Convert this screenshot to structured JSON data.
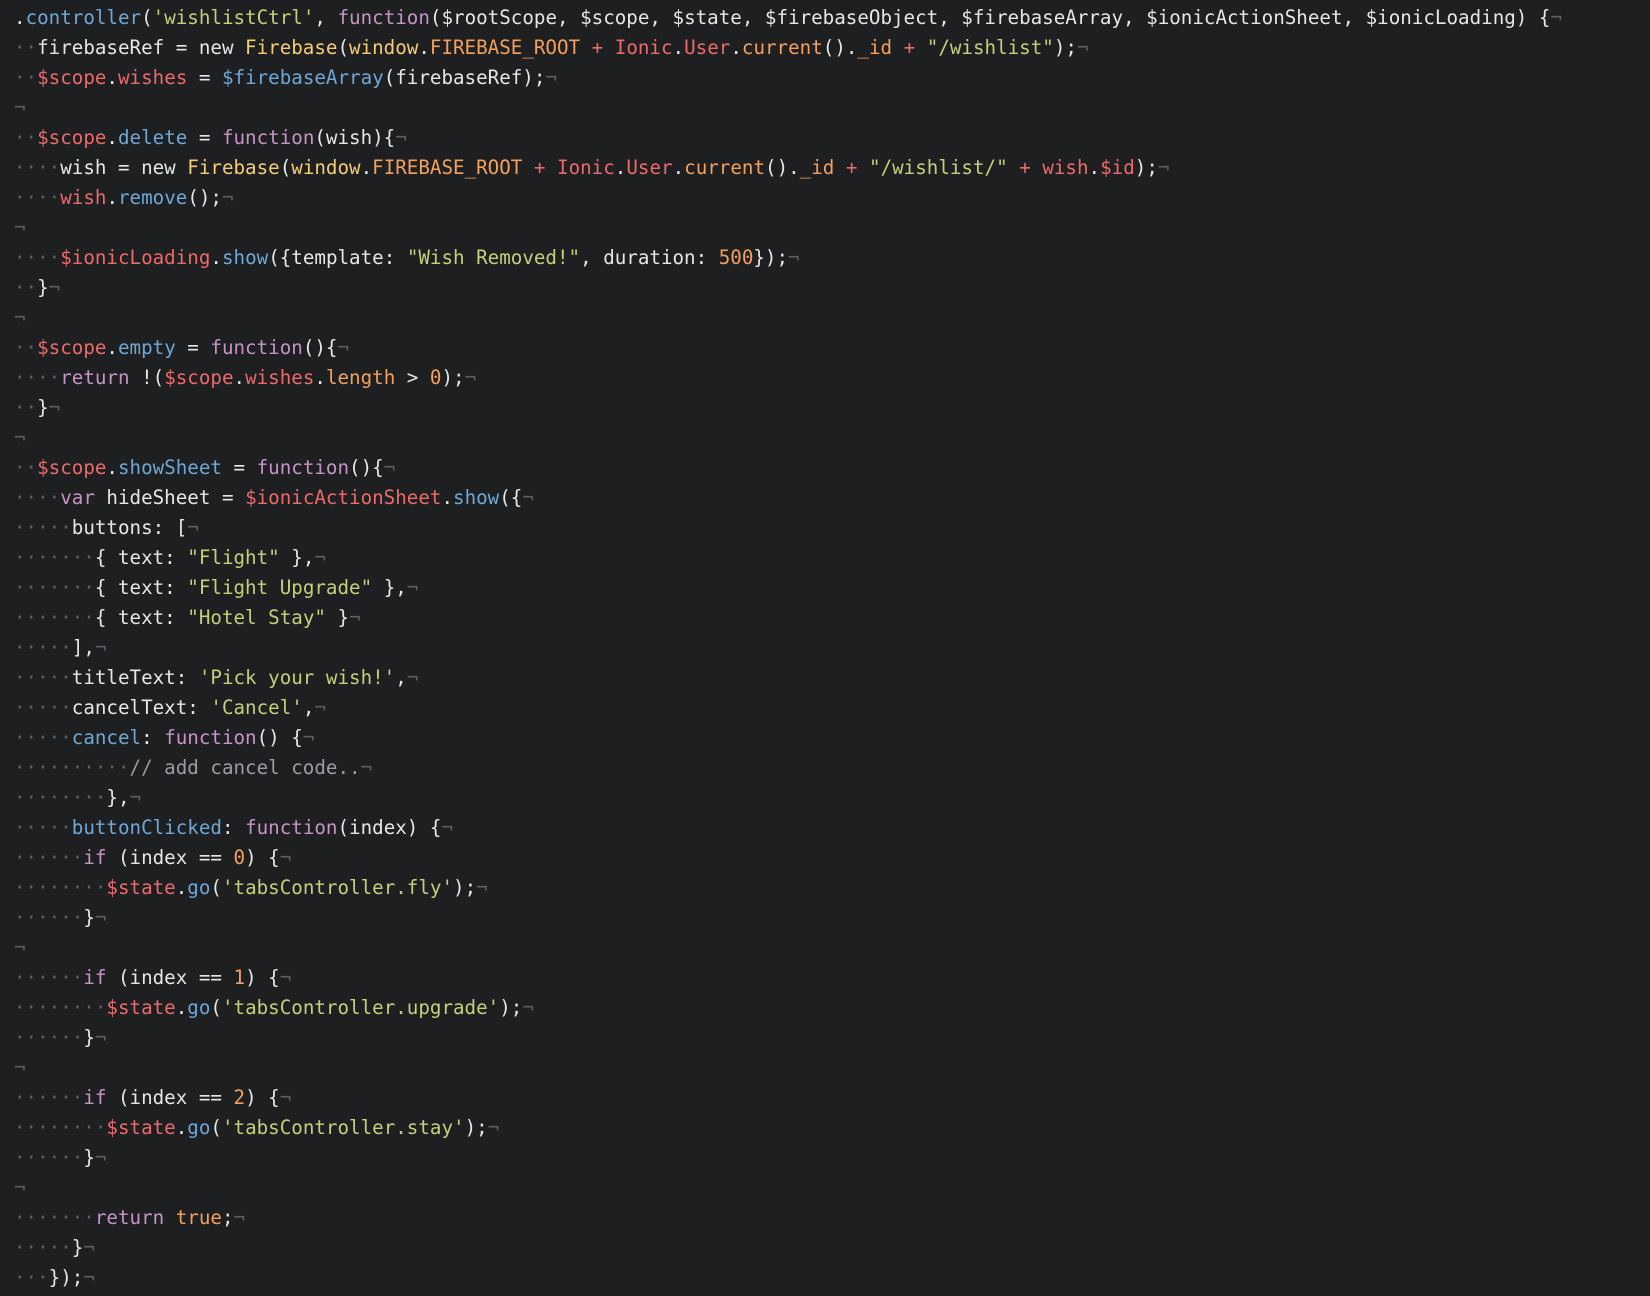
{
  "editor": {
    "lines": [
      [
        [
          "plain",
          "."
        ],
        [
          "func",
          "controller"
        ],
        [
          "plain",
          "("
        ],
        [
          "str",
          "'wishlistCtrl'"
        ],
        [
          "plain",
          ", "
        ],
        [
          "key",
          "function"
        ],
        [
          "plain",
          "($rootScope, $scope, $state, $firebaseObject, $firebaseArray, $ionicActionSheet, $ionicLoading) {"
        ],
        [
          "inv",
          "¬"
        ]
      ],
      [
        [
          "inv",
          "··"
        ],
        [
          "plain",
          "firebaseRef = new "
        ],
        [
          "class",
          "Firebase"
        ],
        [
          "plain",
          "("
        ],
        [
          "class",
          "window"
        ],
        [
          "plain",
          "."
        ],
        [
          "const",
          "FIREBASE_ROOT"
        ],
        [
          "plain",
          " "
        ],
        [
          "var",
          "+"
        ],
        [
          "plain",
          " "
        ],
        [
          "var",
          "Ionic"
        ],
        [
          "plain",
          "."
        ],
        [
          "var",
          "User"
        ],
        [
          "plain",
          "."
        ],
        [
          "const",
          "current"
        ],
        [
          "plain",
          "()."
        ],
        [
          "const",
          "_id"
        ],
        [
          "plain",
          " "
        ],
        [
          "var",
          "+"
        ],
        [
          "plain",
          " "
        ],
        [
          "str",
          "\"/wishlist\""
        ],
        [
          "plain",
          ");"
        ],
        [
          "inv",
          "¬"
        ]
      ],
      [
        [
          "inv",
          "··"
        ],
        [
          "var",
          "$scope"
        ],
        [
          "plain",
          "."
        ],
        [
          "var",
          "wishes"
        ],
        [
          "plain",
          " = "
        ],
        [
          "func",
          "$firebaseArray"
        ],
        [
          "plain",
          "(firebaseRef);"
        ],
        [
          "inv",
          "¬"
        ]
      ],
      [
        [
          "inv",
          "¬"
        ]
      ],
      [
        [
          "inv",
          "··"
        ],
        [
          "var",
          "$scope"
        ],
        [
          "plain",
          "."
        ],
        [
          "func",
          "delete"
        ],
        [
          "plain",
          " = "
        ],
        [
          "key",
          "function"
        ],
        [
          "plain",
          "(wish){"
        ],
        [
          "inv",
          "¬"
        ]
      ],
      [
        [
          "inv",
          "····"
        ],
        [
          "plain",
          "wish = new "
        ],
        [
          "class",
          "Firebase"
        ],
        [
          "plain",
          "("
        ],
        [
          "class",
          "window"
        ],
        [
          "plain",
          "."
        ],
        [
          "const",
          "FIREBASE_ROOT"
        ],
        [
          "plain",
          " "
        ],
        [
          "var",
          "+"
        ],
        [
          "plain",
          " "
        ],
        [
          "var",
          "Ionic"
        ],
        [
          "plain",
          "."
        ],
        [
          "var",
          "User"
        ],
        [
          "plain",
          "."
        ],
        [
          "const",
          "current"
        ],
        [
          "plain",
          "()."
        ],
        [
          "const",
          "_id"
        ],
        [
          "plain",
          " "
        ],
        [
          "var",
          "+"
        ],
        [
          "plain",
          " "
        ],
        [
          "str",
          "\"/wishlist/\""
        ],
        [
          "plain",
          " "
        ],
        [
          "var",
          "+"
        ],
        [
          "plain",
          " "
        ],
        [
          "var",
          "wish"
        ],
        [
          "plain",
          "."
        ],
        [
          "var",
          "$id"
        ],
        [
          "plain",
          ");"
        ],
        [
          "inv",
          "¬"
        ]
      ],
      [
        [
          "inv",
          "····"
        ],
        [
          "var",
          "wish"
        ],
        [
          "plain",
          "."
        ],
        [
          "func",
          "remove"
        ],
        [
          "plain",
          "();"
        ],
        [
          "inv",
          "¬"
        ]
      ],
      [
        [
          "inv",
          "¬"
        ]
      ],
      [
        [
          "inv",
          "····"
        ],
        [
          "var",
          "$ionicLoading"
        ],
        [
          "plain",
          "."
        ],
        [
          "func",
          "show"
        ],
        [
          "plain",
          "({template: "
        ],
        [
          "str",
          "\"Wish Removed!\""
        ],
        [
          "plain",
          ", duration: "
        ],
        [
          "num",
          "500"
        ],
        [
          "plain",
          "});"
        ],
        [
          "inv",
          "¬"
        ]
      ],
      [
        [
          "inv",
          "··"
        ],
        [
          "plain",
          "}"
        ],
        [
          "inv",
          "¬"
        ]
      ],
      [
        [
          "inv",
          "¬"
        ]
      ],
      [
        [
          "inv",
          "··"
        ],
        [
          "var",
          "$scope"
        ],
        [
          "plain",
          "."
        ],
        [
          "func",
          "empty"
        ],
        [
          "plain",
          " = "
        ],
        [
          "key",
          "function"
        ],
        [
          "plain",
          "(){"
        ],
        [
          "inv",
          "¬"
        ]
      ],
      [
        [
          "inv",
          "····"
        ],
        [
          "key",
          "return"
        ],
        [
          "plain",
          " !("
        ],
        [
          "var",
          "$scope"
        ],
        [
          "plain",
          "."
        ],
        [
          "var",
          "wishes"
        ],
        [
          "plain",
          "."
        ],
        [
          "const",
          "length"
        ],
        [
          "plain",
          " > "
        ],
        [
          "num",
          "0"
        ],
        [
          "plain",
          ");"
        ],
        [
          "inv",
          "¬"
        ]
      ],
      [
        [
          "inv",
          "··"
        ],
        [
          "plain",
          "}"
        ],
        [
          "inv",
          "¬"
        ]
      ],
      [
        [
          "inv",
          "¬"
        ]
      ],
      [
        [
          "inv",
          "··"
        ],
        [
          "var",
          "$scope"
        ],
        [
          "plain",
          "."
        ],
        [
          "func",
          "showSheet"
        ],
        [
          "plain",
          " = "
        ],
        [
          "key",
          "function"
        ],
        [
          "plain",
          "(){"
        ],
        [
          "inv",
          "¬"
        ]
      ],
      [
        [
          "inv",
          "····"
        ],
        [
          "key",
          "var"
        ],
        [
          "plain",
          " hideSheet = "
        ],
        [
          "var",
          "$ionicActionSheet"
        ],
        [
          "plain",
          "."
        ],
        [
          "func",
          "show"
        ],
        [
          "plain",
          "({"
        ],
        [
          "inv",
          "¬"
        ]
      ],
      [
        [
          "inv",
          "·····"
        ],
        [
          "plain",
          "buttons: ["
        ],
        [
          "inv",
          "¬"
        ]
      ],
      [
        [
          "inv",
          "·······"
        ],
        [
          "plain",
          "{ text: "
        ],
        [
          "str",
          "\"Flight\""
        ],
        [
          "plain",
          " },"
        ],
        [
          "inv",
          "¬"
        ]
      ],
      [
        [
          "inv",
          "·······"
        ],
        [
          "plain",
          "{ text: "
        ],
        [
          "str",
          "\"Flight Upgrade\""
        ],
        [
          "plain",
          " },"
        ],
        [
          "inv",
          "¬"
        ]
      ],
      [
        [
          "inv",
          "·······"
        ],
        [
          "plain",
          "{ text: "
        ],
        [
          "str",
          "\"Hotel Stay\""
        ],
        [
          "plain",
          " }"
        ],
        [
          "inv",
          "¬"
        ]
      ],
      [
        [
          "inv",
          "·····"
        ],
        [
          "plain",
          "],"
        ],
        [
          "inv",
          "¬"
        ]
      ],
      [
        [
          "inv",
          "·····"
        ],
        [
          "plain",
          "titleText: "
        ],
        [
          "str",
          "'Pick your wish!'"
        ],
        [
          "plain",
          ","
        ],
        [
          "inv",
          "¬"
        ]
      ],
      [
        [
          "inv",
          "·····"
        ],
        [
          "plain",
          "cancelText: "
        ],
        [
          "str",
          "'Cancel'"
        ],
        [
          "plain",
          ","
        ],
        [
          "inv",
          "¬"
        ]
      ],
      [
        [
          "inv",
          "·····"
        ],
        [
          "func",
          "cancel"
        ],
        [
          "plain",
          ": "
        ],
        [
          "key",
          "function"
        ],
        [
          "plain",
          "() {"
        ],
        [
          "inv",
          "¬"
        ]
      ],
      [
        [
          "inv",
          "··········"
        ],
        [
          "comment",
          "// add cancel code.."
        ],
        [
          "inv",
          "¬"
        ]
      ],
      [
        [
          "inv",
          "········"
        ],
        [
          "plain",
          "},"
        ],
        [
          "inv",
          "¬"
        ]
      ],
      [
        [
          "inv",
          "·····"
        ],
        [
          "func",
          "buttonClicked"
        ],
        [
          "plain",
          ": "
        ],
        [
          "key",
          "function"
        ],
        [
          "plain",
          "(index) {"
        ],
        [
          "inv",
          "¬"
        ]
      ],
      [
        [
          "inv",
          "······"
        ],
        [
          "key",
          "if"
        ],
        [
          "plain",
          " (index == "
        ],
        [
          "num",
          "0"
        ],
        [
          "plain",
          ") {"
        ],
        [
          "inv",
          "¬"
        ]
      ],
      [
        [
          "inv",
          "········"
        ],
        [
          "var",
          "$state"
        ],
        [
          "plain",
          "."
        ],
        [
          "func",
          "go"
        ],
        [
          "plain",
          "("
        ],
        [
          "str",
          "'tabsController.fly'"
        ],
        [
          "plain",
          ");"
        ],
        [
          "inv",
          "¬"
        ]
      ],
      [
        [
          "inv",
          "······"
        ],
        [
          "plain",
          "}"
        ],
        [
          "inv",
          "¬"
        ]
      ],
      [
        [
          "inv",
          "¬"
        ]
      ],
      [
        [
          "inv",
          "······"
        ],
        [
          "key",
          "if"
        ],
        [
          "plain",
          " (index == "
        ],
        [
          "num",
          "1"
        ],
        [
          "plain",
          ") {"
        ],
        [
          "inv",
          "¬"
        ]
      ],
      [
        [
          "inv",
          "········"
        ],
        [
          "var",
          "$state"
        ],
        [
          "plain",
          "."
        ],
        [
          "func",
          "go"
        ],
        [
          "plain",
          "("
        ],
        [
          "str",
          "'tabsController.upgrade'"
        ],
        [
          "plain",
          ");"
        ],
        [
          "inv",
          "¬"
        ]
      ],
      [
        [
          "inv",
          "······"
        ],
        [
          "plain",
          "}"
        ],
        [
          "inv",
          "¬"
        ]
      ],
      [
        [
          "inv",
          "¬"
        ]
      ],
      [
        [
          "inv",
          "······"
        ],
        [
          "key",
          "if"
        ],
        [
          "plain",
          " (index == "
        ],
        [
          "num",
          "2"
        ],
        [
          "plain",
          ") {"
        ],
        [
          "inv",
          "¬"
        ]
      ],
      [
        [
          "inv",
          "········"
        ],
        [
          "var",
          "$state"
        ],
        [
          "plain",
          "."
        ],
        [
          "func",
          "go"
        ],
        [
          "plain",
          "("
        ],
        [
          "str",
          "'tabsController.stay'"
        ],
        [
          "plain",
          ");"
        ],
        [
          "inv",
          "¬"
        ]
      ],
      [
        [
          "inv",
          "······"
        ],
        [
          "plain",
          "}"
        ],
        [
          "inv",
          "¬"
        ]
      ],
      [
        [
          "inv",
          "¬"
        ]
      ],
      [
        [
          "inv",
          "·······"
        ],
        [
          "key",
          "return"
        ],
        [
          "plain",
          " "
        ],
        [
          "const",
          "true"
        ],
        [
          "plain",
          ";"
        ],
        [
          "inv",
          "¬"
        ]
      ],
      [
        [
          "inv",
          "·····"
        ],
        [
          "plain",
          "}"
        ],
        [
          "inv",
          "¬"
        ]
      ],
      [
        [
          "inv",
          "···"
        ],
        [
          "plain",
          "});"
        ],
        [
          "inv",
          "¬"
        ]
      ]
    ]
  }
}
